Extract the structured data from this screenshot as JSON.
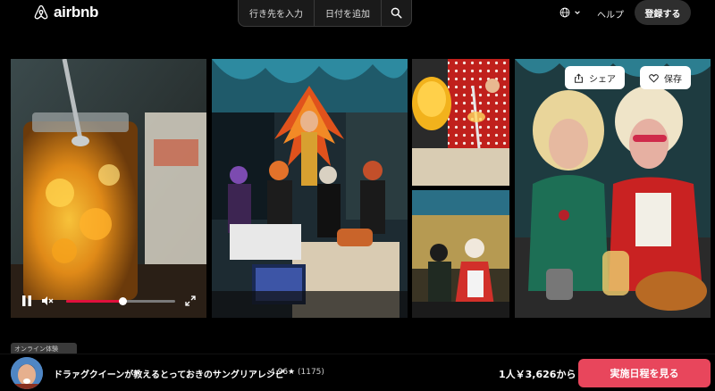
{
  "header": {
    "logo_text": "airbnb",
    "search": {
      "location_label": "行き先を入力",
      "dates_label": "日付を追加"
    },
    "help_label": "ヘルプ",
    "signup_label": "登録する"
  },
  "gallery": {
    "share_label": "シェア",
    "save_label": "保存",
    "video": {
      "progress": 0.52
    }
  },
  "tag_label": "オンライン体験",
  "footer": {
    "title": "ドラァグクイーンが教えるとっておきのサングリアレシピ",
    "rating": "4.96★",
    "reviews": "(1175)",
    "price": "1人￥3,626から",
    "cta_label": "実施日程を見る"
  },
  "colors": {
    "accent": "#e8465c",
    "progress": "#e0103c"
  }
}
